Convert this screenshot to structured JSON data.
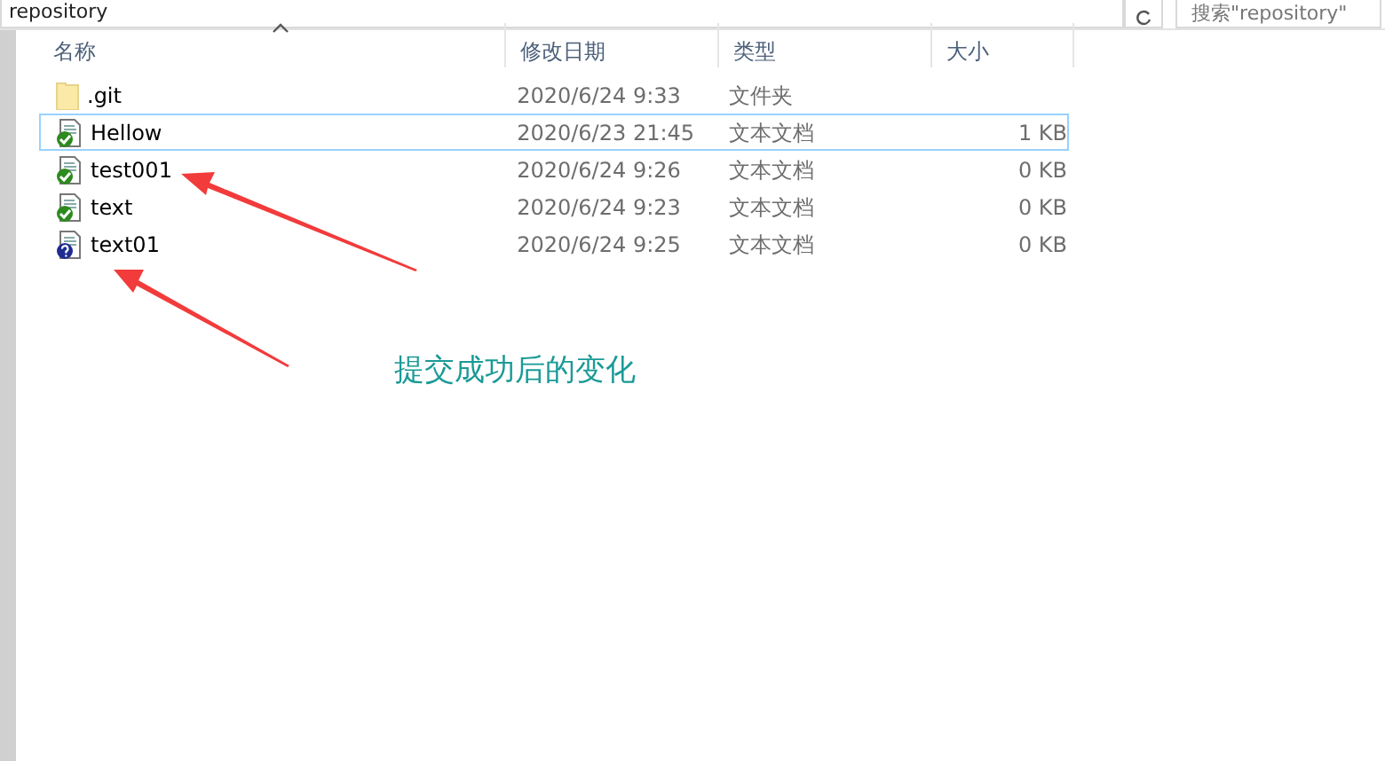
{
  "address_bar": {
    "path": "repository"
  },
  "search": {
    "placeholder": "搜索\"repository\""
  },
  "columns": [
    {
      "label": "名称",
      "sorted": true
    },
    {
      "label": "修改日期",
      "sorted": false
    },
    {
      "label": "类型",
      "sorted": false
    },
    {
      "label": "大小",
      "sorted": false
    }
  ],
  "rows": [
    {
      "kind": "folder",
      "name": ".git",
      "modified": "2020/6/24 9:33",
      "type": "文件夹",
      "selected": false
    },
    {
      "kind": "committed",
      "name": "Hellow",
      "modified": "2020/6/23 21:45",
      "type": "文本文档",
      "size": "1 KB",
      "selected": true
    },
    {
      "kind": "committed",
      "name": "test001",
      "modified": "2020/6/24 9:26",
      "type": "文本文档",
      "size": "0 KB",
      "selected": false
    },
    {
      "kind": "committed",
      "name": "text",
      "modified": "2020/6/24 9:23",
      "type": "文本文档",
      "size": "0 KB",
      "selected": false
    },
    {
      "kind": "untracked",
      "name": "text01",
      "modified": "2020/6/24 9:25",
      "type": "文本文档",
      "size": "0 KB",
      "selected": false
    }
  ],
  "annotation": {
    "caption": "提交成功后的变化"
  }
}
